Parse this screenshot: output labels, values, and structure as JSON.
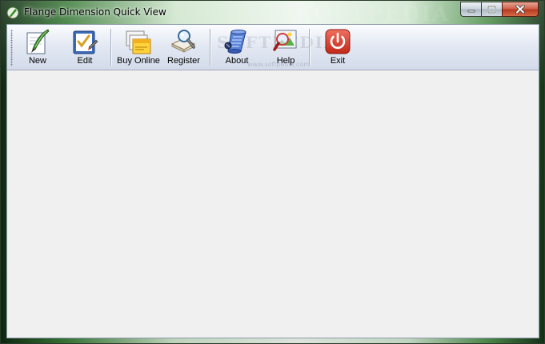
{
  "window": {
    "title": "Flange Dimension Quick View",
    "watermark": "SOFTPEDIA"
  },
  "toolbar": {
    "new_label": "New",
    "edit_label": "Edit",
    "buy_label": "Buy Online",
    "register_label": "Register",
    "about_label": "About",
    "help_label": "Help",
    "exit_label": "Exit",
    "watermark": "SOFTPEDIA",
    "watermark_url": "www.softpedia.com"
  },
  "icons": [
    "app-icon",
    "feather-pen-icon",
    "edit-check-icon",
    "buy-online-icon",
    "register-icon",
    "about-scroll-icon",
    "help-magnifier-icon",
    "power-exit-icon"
  ],
  "colors": {
    "exit_red": "#d83a2a",
    "toolbar_top": "#fbfcfe",
    "toolbar_bottom": "#d3dbea",
    "client_bg": "#f0f0f0"
  }
}
